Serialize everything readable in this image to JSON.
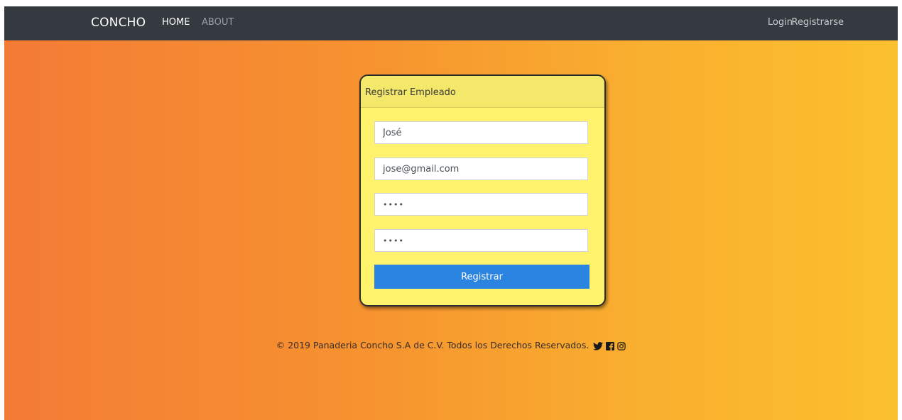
{
  "navbar": {
    "brand": "CONCHO",
    "links": {
      "home": "HOME",
      "about": "ABOUT"
    },
    "right": {
      "login": "Login",
      "register": "Registrarse"
    }
  },
  "card": {
    "title": "Registrar Empleado",
    "fields": {
      "name": "José",
      "email": "jose@gmail.com",
      "password": "••••",
      "confirm": "••••"
    },
    "submit_label": "Registrar"
  },
  "footer": {
    "text": "© 2019 Panaderia Concho S.A de C.V. Todos los Derechos Reservados.",
    "icons": [
      "twitter-icon",
      "facebook-icon",
      "instagram-icon"
    ]
  },
  "colors": {
    "navbar_bg": "#343a40",
    "gradient_start": "#f47b36",
    "gradient_end": "#fbc02d",
    "card_bg": "#fff36e",
    "button_bg": "#2a84e0"
  }
}
